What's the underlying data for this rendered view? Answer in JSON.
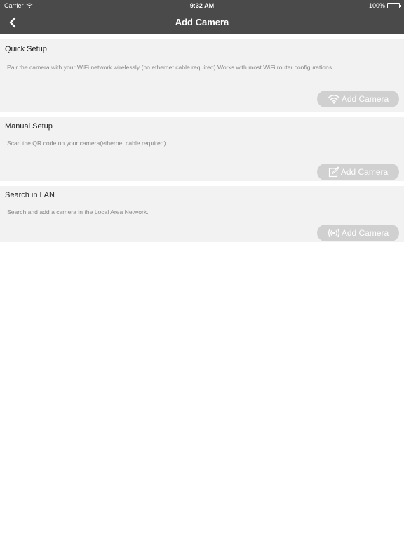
{
  "status_bar": {
    "carrier": "Carrier",
    "time": "9:32 AM",
    "battery": "100%"
  },
  "nav": {
    "title": "Add Camera",
    "back_icon": "chevron-left-icon"
  },
  "sections": [
    {
      "title": "Quick Setup",
      "description": "Pair the camera with your WiFi network wirelessly (no ethernet cable required).Works with most WiFi router configurations.",
      "button_label": "Add Camera",
      "button_icon": "wifi-icon"
    },
    {
      "title": "Manual Setup",
      "description": "Scan the QR code on your camera(ethernet cable required).",
      "button_label": "Add Camera",
      "button_icon": "edit-icon"
    },
    {
      "title": "Search in LAN",
      "description": "Search and add a camera in the Local Area Network.",
      "button_label": "Add Camera",
      "button_icon": "broadcast-icon"
    }
  ],
  "colors": {
    "bar": "#4a4a4a",
    "card": "#f2f2f2",
    "button": "#d0d0d0"
  }
}
